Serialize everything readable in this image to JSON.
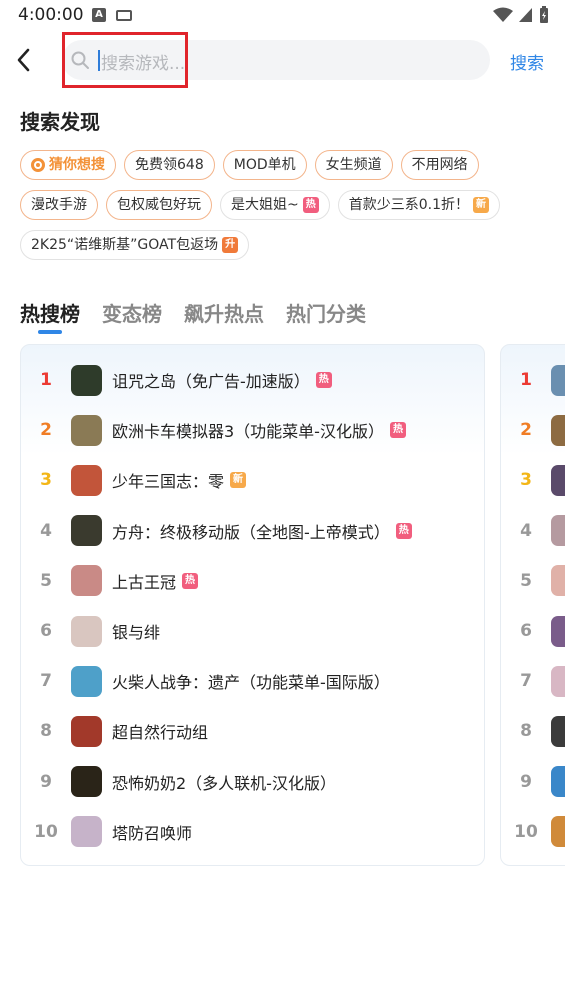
{
  "status": {
    "time": "4:00:00",
    "notif_a": "A"
  },
  "search": {
    "placeholder": "搜索游戏...",
    "submit_label": "搜索"
  },
  "discover": {
    "title": "搜索发现",
    "tags": [
      {
        "label": "猜你想搜",
        "style": "guess"
      },
      {
        "label": "免费领648",
        "style": "orange"
      },
      {
        "label": "MOD单机",
        "style": "orange"
      },
      {
        "label": "女生频道",
        "style": "orange"
      },
      {
        "label": "不用网络",
        "style": "orange"
      },
      {
        "label": "漫改手游",
        "style": "orange"
      },
      {
        "label": "包权威包好玩",
        "style": "orange"
      },
      {
        "label": "是大姐姐~",
        "badge": "热",
        "style": "plain"
      },
      {
        "label": "首款少三系0.1折！",
        "badge": "新",
        "style": "plain"
      },
      {
        "label": "2K25“诺维斯基”GOAT包返场",
        "badge": "升",
        "style": "plain"
      }
    ]
  },
  "rank_tabs": [
    "热搜榜",
    "变态榜",
    "飙升热点",
    "热门分类"
  ],
  "ranking": [
    {
      "rank": "1",
      "name": "诅咒之岛（免广告-加速版）",
      "badge": "热",
      "color": "#2e3b2a"
    },
    {
      "rank": "2",
      "name": "欧洲卡车模拟器3（功能菜单-汉化版）",
      "badge": "热",
      "color": "#8a7a55"
    },
    {
      "rank": "3",
      "name": "少年三国志：零",
      "badge": "新",
      "color": "#c2553a"
    },
    {
      "rank": "4",
      "name": "方舟：终极移动版（全地图-上帝模式）",
      "badge": "热",
      "color": "#3a3a2e"
    },
    {
      "rank": "5",
      "name": "上古王冠",
      "badge": "热",
      "color": "#c98a86"
    },
    {
      "rank": "6",
      "name": "银与绯",
      "badge": "",
      "color": "#d9c6c0"
    },
    {
      "rank": "7",
      "name": "火柴人战争：遗产（功能菜单-国际版）",
      "badge": "",
      "color": "#4ea0c9"
    },
    {
      "rank": "8",
      "name": "超自然行动组",
      "badge": "",
      "color": "#a2392a"
    },
    {
      "rank": "9",
      "name": "恐怖奶奶2（多人联机-汉化版）",
      "badge": "",
      "color": "#2a2418"
    },
    {
      "rank": "10",
      "name": "塔防召唤师",
      "badge": "",
      "color": "#c6b3c9"
    }
  ],
  "next_card_ranks": [
    "1",
    "2",
    "3",
    "4",
    "5",
    "6",
    "7",
    "8",
    "9",
    "10"
  ],
  "next_card_colors": [
    "#6a8fb0",
    "#8d6b42",
    "#5a4a6a",
    "#b59aa0",
    "#e0b1a8",
    "#7a5c8a",
    "#d8b7c4",
    "#3b3b3b",
    "#3a87c9",
    "#d08a3a"
  ],
  "colors": {
    "accent": "#2f86e6",
    "highlight_border": "#e0242b"
  }
}
